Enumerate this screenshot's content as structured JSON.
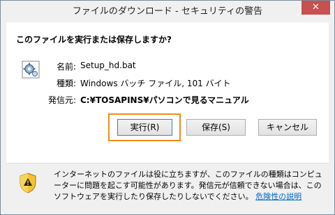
{
  "window": {
    "title": "ファイルのダウンロード - セキュリティの警告",
    "close_label": "✕"
  },
  "question": "このファイルを実行または保存しますか?",
  "file": {
    "icon": "gear-file-icon",
    "name_label": "名前:",
    "name_value": "Setup_hd.bat",
    "type_label": "種類:",
    "type_value": "Windows バッチ ファイル, 101 バイト",
    "from_label": "発信元:",
    "from_value": "C:¥TOSAPINS¥パソコンで見るマニュアル"
  },
  "buttons": {
    "run": "実行(R)",
    "save": "保存(S)",
    "cancel": "キャンセル"
  },
  "warning": {
    "icon": "shield-warning-icon",
    "text": "インターネットのファイルは役に立ちますが、このファイルの種類はコンピューターに問題を起こす可能性があります。発信元が信頼できない場合は、このソフトウェアを実行したり保存したりしないでください。",
    "link": "危険性の説明"
  },
  "colors": {
    "highlight": "#f08c1a",
    "close_button": "#c75050",
    "link": "#0066cc"
  }
}
